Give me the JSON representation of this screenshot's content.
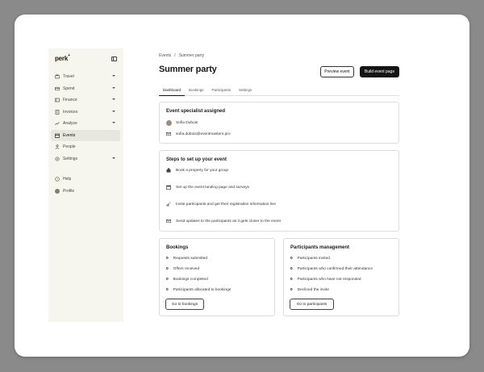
{
  "app": {
    "logo": "perk",
    "logo_mark": "+"
  },
  "sidebar": {
    "items": [
      {
        "label": "Travel",
        "icon": "plane-icon",
        "chevron": true,
        "active": false
      },
      {
        "label": "Spend",
        "icon": "card-icon",
        "chevron": true,
        "active": false
      },
      {
        "label": "Finance",
        "icon": "bank-icon",
        "chevron": true,
        "active": false
      },
      {
        "label": "Invoices",
        "icon": "invoice-icon",
        "chevron": true,
        "active": false
      },
      {
        "label": "Analyze",
        "icon": "chart-icon",
        "chevron": true,
        "active": false
      },
      {
        "label": "Events",
        "icon": "calendar-icon",
        "chevron": false,
        "active": true
      },
      {
        "label": "People",
        "icon": "person-icon",
        "chevron": false,
        "active": false
      },
      {
        "label": "Settings",
        "icon": "gear-icon",
        "chevron": true,
        "active": false
      }
    ],
    "bottom": [
      {
        "label": "Help",
        "icon": "help-icon"
      },
      {
        "label": "Profile",
        "icon": "avatar"
      }
    ]
  },
  "breadcrumb": {
    "parent": "Events",
    "separator": "/",
    "current": "Summer party"
  },
  "page": {
    "title": "Summer party"
  },
  "header_buttons": {
    "preview": "Preview event",
    "build": "Build event page"
  },
  "tabs": [
    {
      "label": "Dashboard",
      "active": true
    },
    {
      "label": "Bookings",
      "active": false
    },
    {
      "label": "Participants",
      "active": false
    },
    {
      "label": "Settings",
      "active": false
    }
  ],
  "specialist": {
    "title": "Event specialist assigned",
    "name": "Sofia Dubois",
    "email": "sofia.dubois@eventmasters.pro"
  },
  "steps": {
    "title": "Steps to set up your event",
    "items": [
      {
        "label": "Book a property for your group",
        "icon": "building-icon"
      },
      {
        "label": "Set up the event landing page and surveys",
        "icon": "calendar-icon"
      },
      {
        "label": "Invite participants and get their registration information live",
        "icon": "invite-icon"
      },
      {
        "label": "Send updates to the participants as it gets closer to the event",
        "icon": "mail-icon"
      }
    ]
  },
  "bookings": {
    "title": "Bookings",
    "rows": [
      {
        "count": "0",
        "label": "Requests submitted"
      },
      {
        "count": "0",
        "label": "Offers received"
      },
      {
        "count": "0",
        "label": "Bookings completed"
      },
      {
        "count": "0",
        "label": "Participants allocated to bookings"
      }
    ],
    "button": "Go to bookings"
  },
  "participants": {
    "title": "Participants management",
    "rows": [
      {
        "count": "0",
        "label": "Participants invited"
      },
      {
        "count": "0",
        "label": "Participants who confirmed their attendance"
      },
      {
        "count": "0",
        "label": "Participants who have not responded"
      },
      {
        "count": "0",
        "label": "Declined the invite"
      }
    ],
    "button": "Go to participants"
  },
  "colors": {
    "sidebar_bg": "#f6f6ef",
    "primary_dark": "#151515",
    "backdrop": "#8a8a8a"
  }
}
